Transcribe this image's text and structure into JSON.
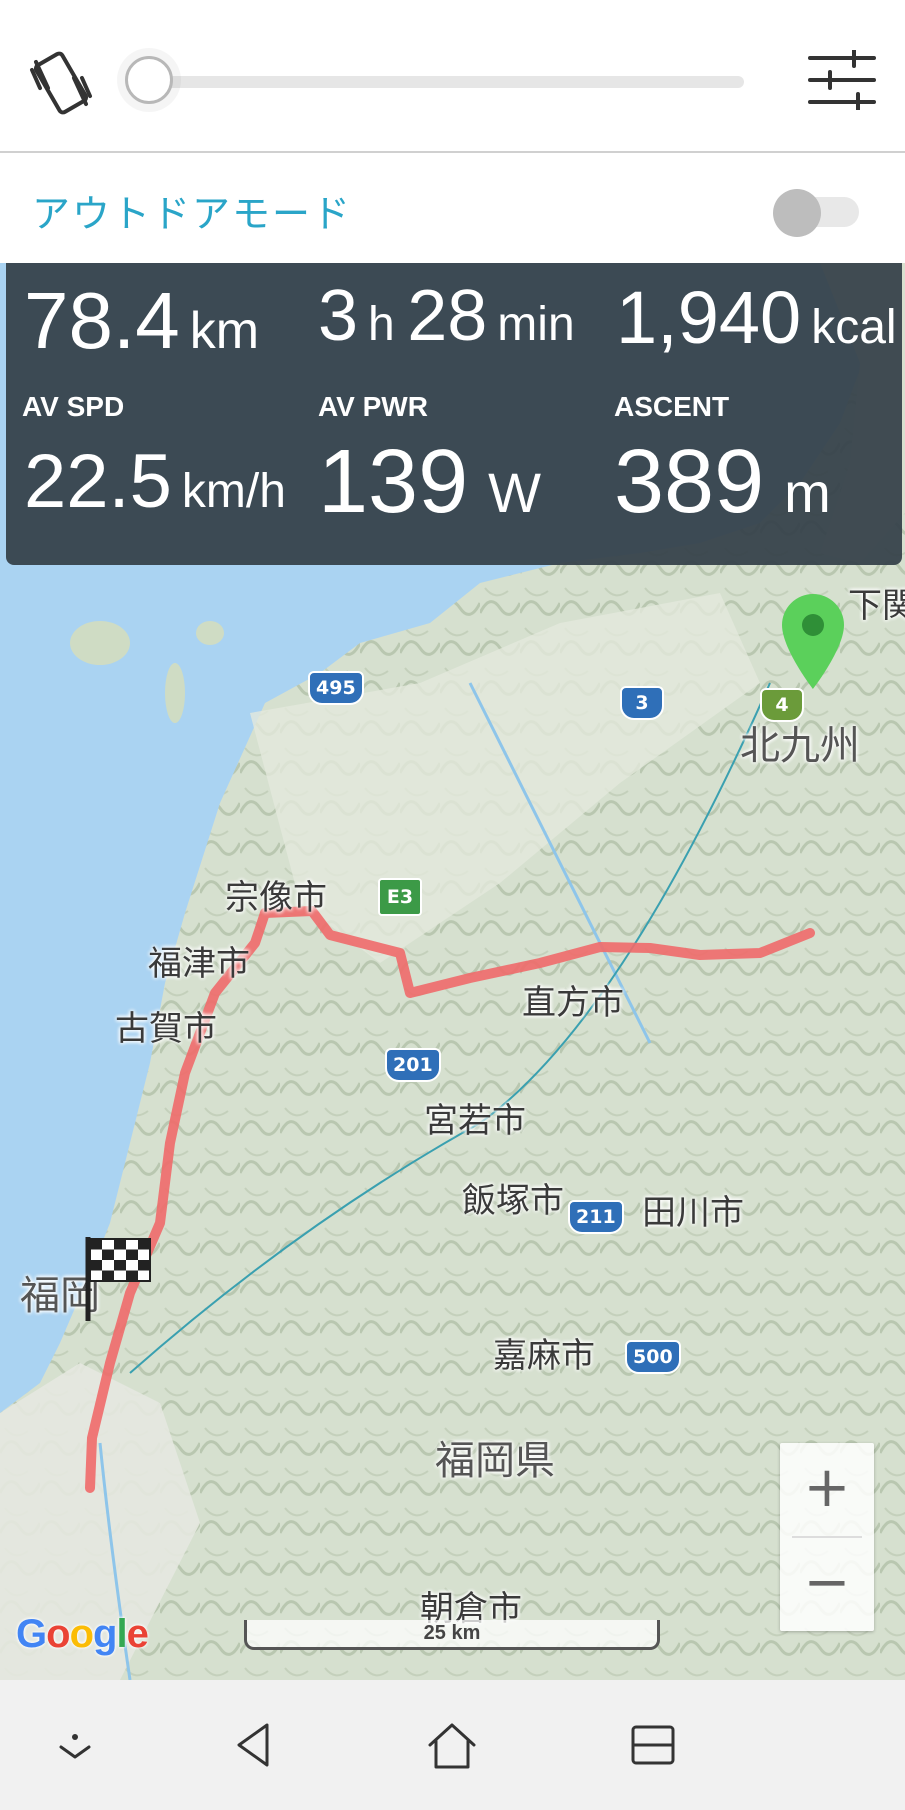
{
  "toolbar": {
    "vibration_icon": "vibration-icon",
    "brightness_slider_level": 0,
    "settings_icon": "sliders-icon"
  },
  "outdoor_mode": {
    "label": "アウトドアモード",
    "enabled": false
  },
  "stats": {
    "distance": {
      "value": "78.4",
      "unit": "km"
    },
    "time": {
      "hours": "3",
      "hours_unit": "h",
      "minutes": "28",
      "minutes_unit": "min"
    },
    "calories": {
      "value": "1,940",
      "unit": "kcal"
    },
    "avg_speed": {
      "label": "AV SPD",
      "value": "22.5",
      "unit": "km/h"
    },
    "avg_power": {
      "label": "AV PWR",
      "value": "139",
      "unit": "W"
    },
    "ascent": {
      "label": "ASCENT",
      "value": "389",
      "unit": "m"
    }
  },
  "map": {
    "labels": {
      "shimonoseki": "下関",
      "kitakyushu": "北九州",
      "munakata": "宗像市",
      "fukutsu": "福津市",
      "koga": "古賀市",
      "nogata": "直方市",
      "miyawaka": "宮若市",
      "iizuka": "飯塚市",
      "tagawa": "田川市",
      "fukuoka": "福岡",
      "kama": "嘉麻市",
      "fukuoka_pref": "福岡県",
      "asakura": "朝倉市"
    },
    "road_shields": {
      "r495": "495",
      "r3": "3",
      "r4": "4",
      "e3": "E3",
      "r201": "201",
      "r211": "211",
      "r500": "500"
    },
    "scale_label": "25 km",
    "attribution": "Google",
    "zoom_in": "+",
    "zoom_out": "−",
    "start_marker_icon": "green-pin-icon",
    "finish_marker_icon": "checkered-flag-icon",
    "route_color": "#ef6a6a",
    "sea_color": "#aad3f2"
  },
  "navbar": {
    "icons": [
      "chevron-down-icon",
      "back-icon",
      "home-icon",
      "recents-icon"
    ]
  }
}
